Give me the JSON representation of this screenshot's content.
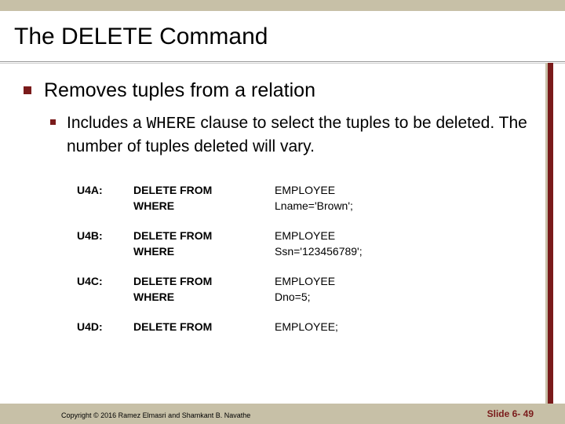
{
  "title": "The DELETE Command",
  "bullet1": "Removes tuples from a relation",
  "bullet2_a": "Includes a ",
  "bullet2_code": "WHERE",
  "bullet2_b": " clause to select the tuples to be deleted. The number of tuples deleted will vary.",
  "statements": [
    {
      "id": "U4A:",
      "lines": [
        [
          "DELETE FROM",
          "EMPLOYEE"
        ],
        [
          "WHERE",
          "Lname='Brown';"
        ]
      ]
    },
    {
      "id": "U4B:",
      "lines": [
        [
          "DELETE FROM",
          "EMPLOYEE"
        ],
        [
          "WHERE",
          "Ssn='123456789';"
        ]
      ]
    },
    {
      "id": "U4C:",
      "lines": [
        [
          "DELETE FROM",
          "EMPLOYEE"
        ],
        [
          "WHERE",
          "Dno=5;"
        ]
      ]
    },
    {
      "id": "U4D:",
      "lines": [
        [
          "DELETE FROM",
          "EMPLOYEE;"
        ]
      ]
    }
  ],
  "copyright": "Copyright © 2016 Ramez Elmasri and Shamkant B. Navathe",
  "slidenum": "Slide 6- 49"
}
